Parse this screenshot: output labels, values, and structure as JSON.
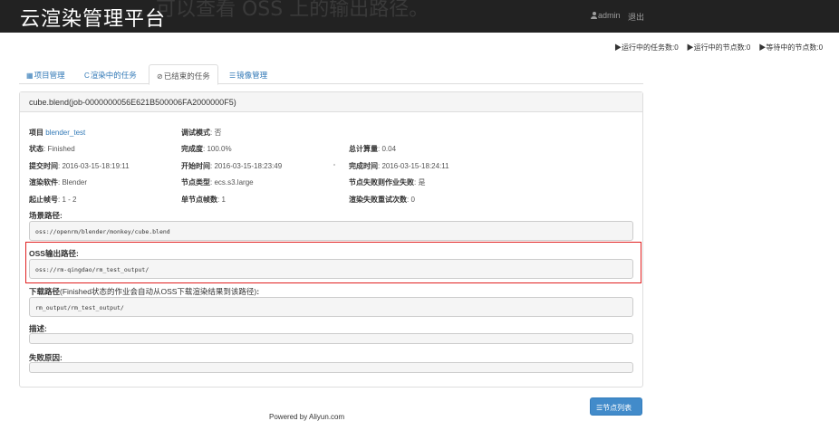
{
  "header": {
    "title": "云渲染管理平台",
    "overlay_text": "，可以查看 OSS 上的输出路径。",
    "user_name": "admin",
    "logout_label": "退出",
    "stats": [
      "▶运行中的任务数:0",
      "▶运行中的节点数:0",
      "▶等待中的节点数:0"
    ]
  },
  "tabs": [
    {
      "icon": "grid-icon",
      "label": "项目管理"
    },
    {
      "icon": "refresh-icon",
      "label": "渲染中的任务"
    },
    {
      "icon": "check-circle-icon",
      "label": "已结束的任务"
    },
    {
      "icon": "list-icon",
      "label": "镜像管理"
    }
  ],
  "job": {
    "title": "cube.blend(job-0000000056E621B500006FA2000000F5)",
    "fields": {
      "project_label": "项目",
      "project_value": "blender_test",
      "debug_label": "调试模式",
      "debug_value": "否",
      "status_label": "状态",
      "status_value": "Finished",
      "progress_label": "完成度",
      "progress_value": "100.0%",
      "compute_label": "总计算量",
      "compute_value": "0.04",
      "submit_label": "提交时间",
      "submit_value": "2016-03-15-18:19:11",
      "start_label": "开始时间",
      "start_value": "2016-03-15-18:23:49",
      "finish_label": "完成时间",
      "finish_value": "2016-03-15-18:24:11",
      "software_label": "渲染软件",
      "software_value": "Blender",
      "node_type_label": "节点类型",
      "node_type_value": "ecs.s3.large",
      "node_fail_label": "节点失败则作业失败",
      "node_fail_value": "是",
      "frames_label": "起止帧号",
      "frames_value": "1 - 2",
      "frames_per_node_label": "单节点帧数",
      "frames_per_node_value": "1",
      "retry_label": "渲染失败重试次数",
      "retry_value": "0"
    },
    "scene_path_label": "场景路径",
    "scene_path": "oss://openrm/blender/monkey/cube.blend",
    "oss_output_label": "OSS输出路径",
    "oss_output": "oss://rm-qingdao/rm_test_output/",
    "download_label": "下载路径",
    "download_hint": "(Finished状态的作业会自动从OSS下载渲染结果到该路径)",
    "download_path": "rm_output/rm_test_output/",
    "description_label": "描述",
    "failure_label": "失败原因"
  },
  "nodes_button": "节点列表",
  "footer": "Powered by Aliyun.com"
}
